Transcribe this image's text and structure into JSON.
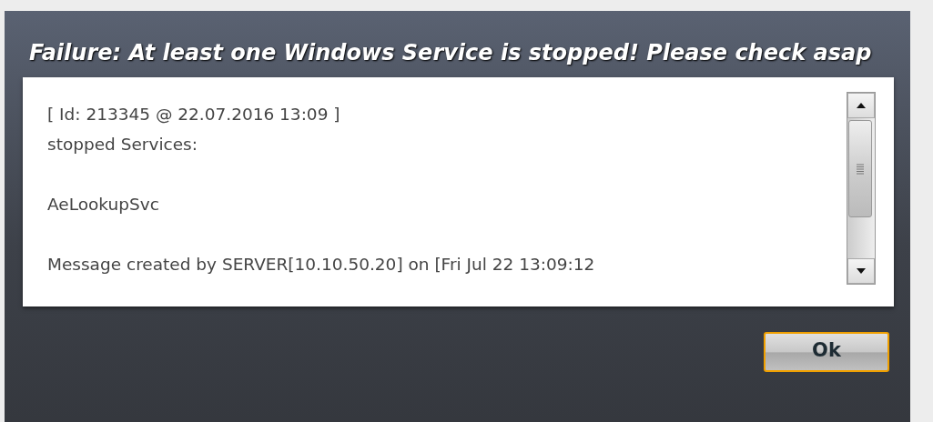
{
  "dialog": {
    "title": "Failure: At least one Windows Service is stopped! Please check asap",
    "message": [
      [
        "[ Id: 213345 @ 22.07.2016 13:09 ]",
        "stopped Services:"
      ],
      [
        "AeLookupSvc"
      ],
      [
        "Message created by SERVER[10.10.50.20] on [Fri Jul 22 13:09:12"
      ]
    ],
    "buttons": [
      {
        "label": "Ok",
        "focused": true
      }
    ]
  }
}
